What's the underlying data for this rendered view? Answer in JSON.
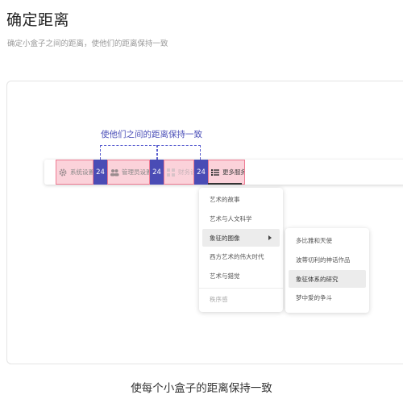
{
  "page": {
    "title": "确定距离",
    "subtitle": "确定小盒子之间的距离，使他们的距离保持一致"
  },
  "annotation": {
    "label": "使他们之间的距离保持一致",
    "gap_value": "24"
  },
  "menubar": {
    "items": [
      {
        "label": "系统设置",
        "icon": "gear-icon"
      },
      {
        "label": "管理员设置",
        "icon": "users-icon"
      },
      {
        "label": "财务设",
        "icon": "grid-icon"
      },
      {
        "label": "更多服务",
        "icon": "list-icon"
      }
    ]
  },
  "dropdown": {
    "items": [
      {
        "label": "艺术的故事"
      },
      {
        "label": "艺术与人文科学"
      },
      {
        "label": "象征的图像"
      },
      {
        "label": "西方艺术的伟大时代"
      },
      {
        "label": "艺术与錯觉"
      },
      {
        "label": "秩序感"
      }
    ]
  },
  "submenu": {
    "items": [
      {
        "label": "多比雅和天使"
      },
      {
        "label": "波蒂切利的神话作品"
      },
      {
        "label": "象征体系的研究"
      },
      {
        "label": "梦中爱的争斗"
      }
    ]
  },
  "caption": "使每个小盒子的距离保持一致",
  "colors": {
    "accent": "#4a4cb5",
    "item_fill": "#fbd2da",
    "item_border": "#ee7a92",
    "dashed": "#5a5fd0"
  }
}
